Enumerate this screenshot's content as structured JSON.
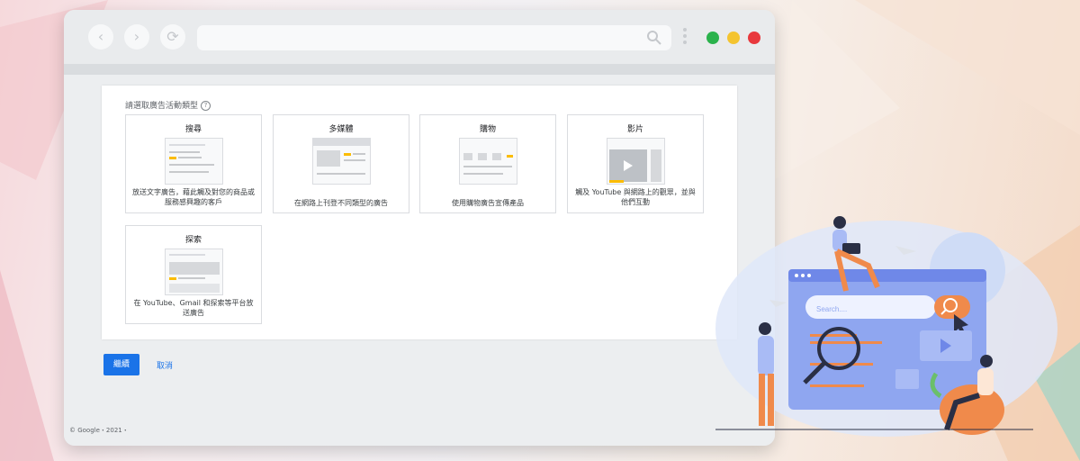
{
  "panel": {
    "title": "請選取廣告活動類型",
    "help_icon": "question-circle-icon"
  },
  "campaign_types": [
    {
      "title": "搜尋",
      "description": "放送文字廣告，藉此觸及對您的商品或服務感興趣的客戶"
    },
    {
      "title": "多媒體",
      "description": "在網路上刊登不同類型的廣告"
    },
    {
      "title": "購物",
      "description": "使用購物廣告宣傳產品"
    },
    {
      "title": "影片",
      "description": "觸及 YouTube 與網路上的觀眾，並與他們互動"
    },
    {
      "title": "探索",
      "description": "在 YouTube、Gmail 和探索等平台放送廣告"
    }
  ],
  "actions": {
    "continue_label": "繼續",
    "cancel_label": "取消"
  },
  "footer": {
    "text": "© Google・2021・"
  },
  "illustration": {
    "search_placeholder": "Search...."
  },
  "colors": {
    "primary": "#1a73e8",
    "accent_yellow": "#fbbc04",
    "light_green": "#2bb24c",
    "light_yellow": "#f4c430",
    "light_red": "#e8383d",
    "illus_orange": "#f08a4b",
    "illus_blue": "#8fa6f0"
  }
}
